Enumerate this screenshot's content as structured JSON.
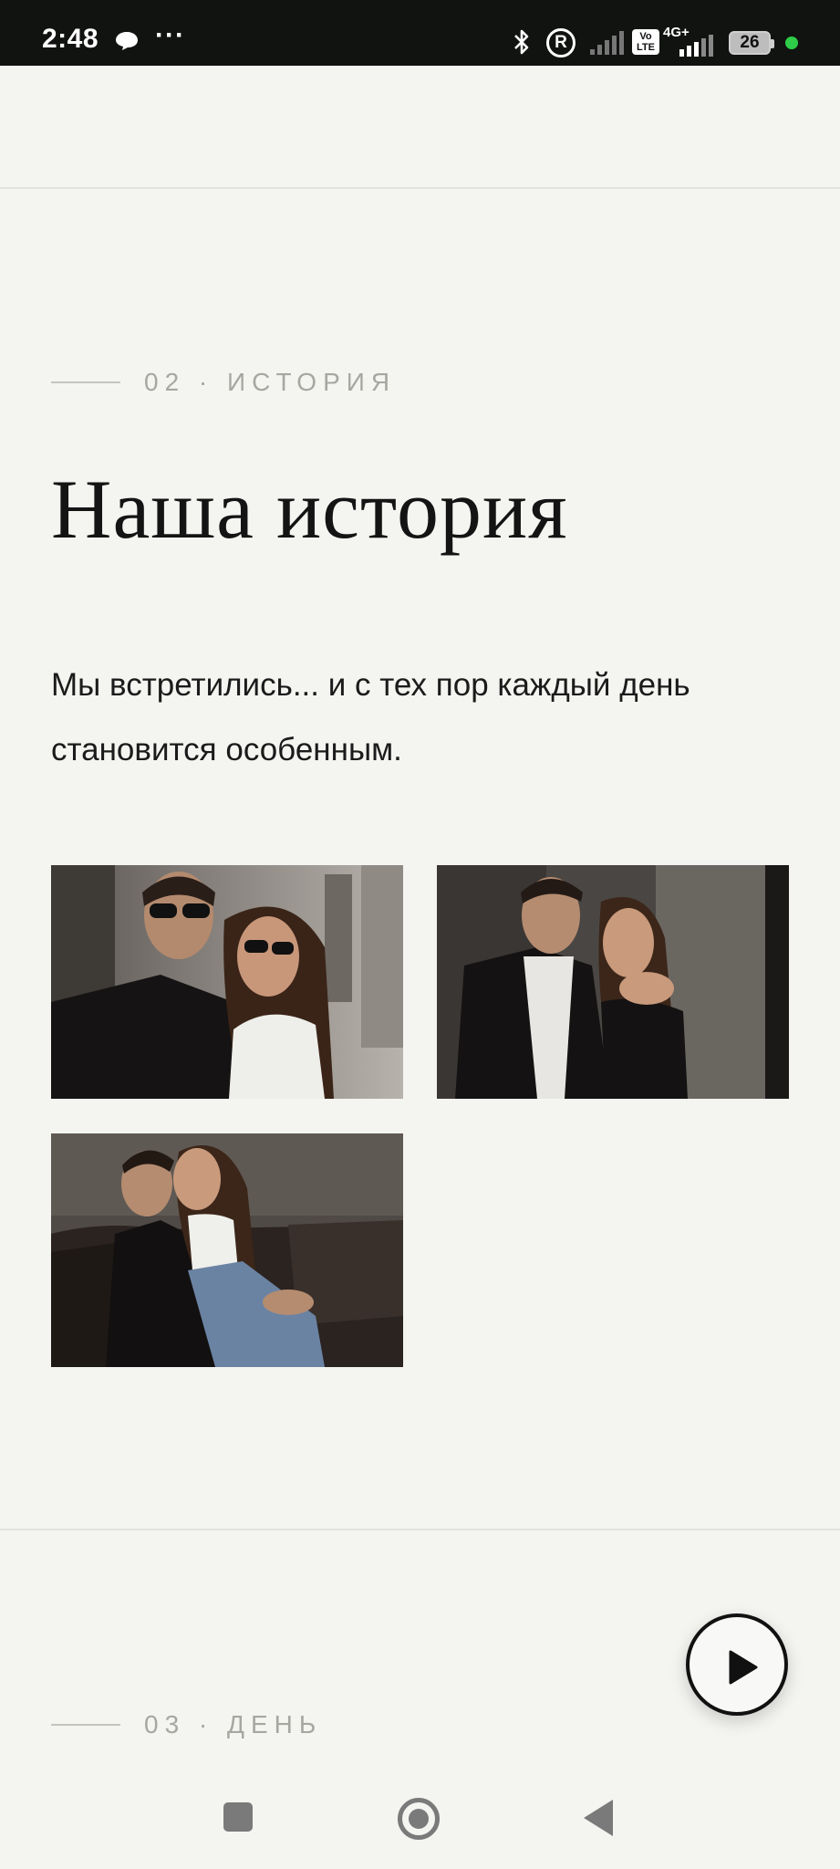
{
  "status_bar": {
    "time": "2:48",
    "dots": "···",
    "r_icon": "R",
    "volte": "Vo LTE",
    "network": "4G+",
    "battery": "26",
    "icons": [
      "chat-bubble-icon",
      "bluetooth-icon",
      "registered-icon",
      "signal-icon",
      "volte-icon",
      "signal-icon",
      "battery-icon",
      "active-dot"
    ]
  },
  "section_history": {
    "eyebrow": "02 · ИСТОРИЯ",
    "title": "Наша история",
    "lead": "Мы встретились... и с тех пор каждый день становится особенным.",
    "photos": [
      "couple-sunglasses-photo",
      "couple-embrace-photo",
      "couple-kiss-photo"
    ]
  },
  "section_day": {
    "eyebrow": "03 · ДЕНЬ"
  },
  "player": {
    "icon": "play-icon"
  },
  "nav_bar": {
    "icons": [
      "recents-icon",
      "home-icon",
      "back-icon"
    ]
  },
  "colors": {
    "background": "#f4f4f1",
    "status_bar": "#111311",
    "eyebrow_text": "#a7a7a2",
    "title_text": "#141414",
    "battery_dot": "#2ecc48"
  }
}
